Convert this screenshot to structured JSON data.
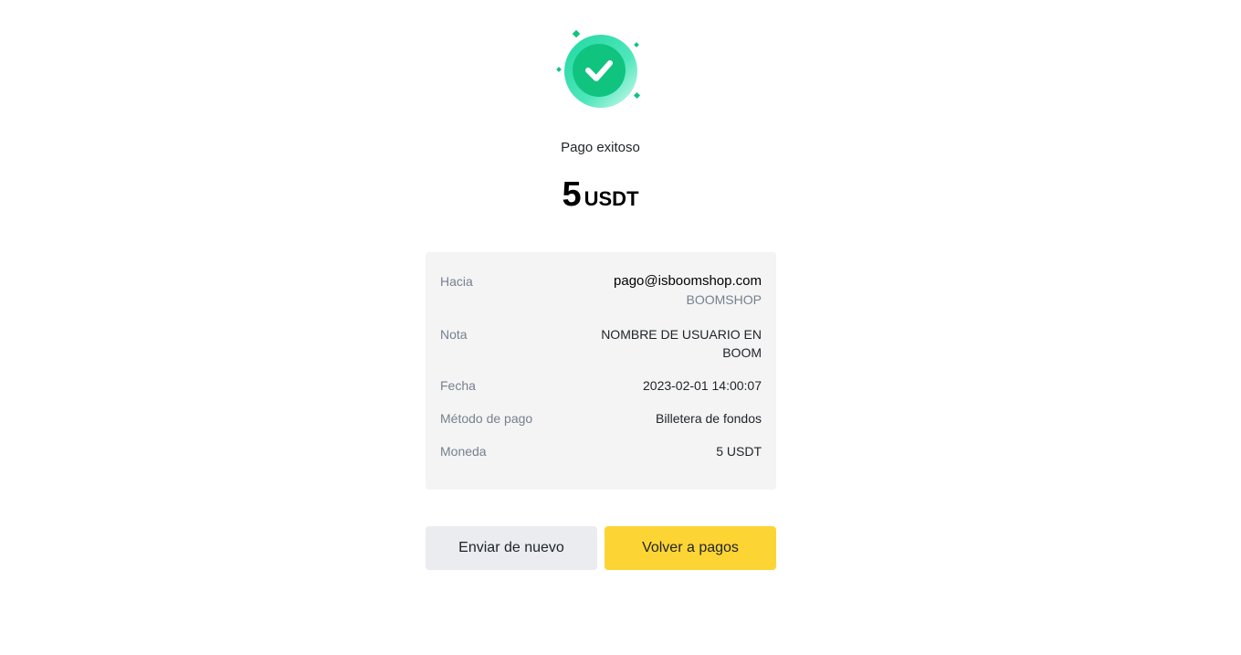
{
  "status": {
    "icon": "check-circle-icon",
    "title": "Pago exitoso"
  },
  "amount": {
    "value": "5",
    "currency": "USDT"
  },
  "details": {
    "to_label": "Hacia",
    "to_email": "pago@isboomshop.com",
    "to_name": "BOOMSHOP",
    "note_label": "Nota",
    "note_line1": "NOMBRE DE USUARIO EN",
    "note_line2": "BOOM",
    "date_label": "Fecha",
    "date_value": "2023-02-01 14:00:07",
    "method_label": "Método de pago",
    "method_value": "Billetera de fondos",
    "currency_label": "Moneda",
    "currency_value": "5 USDT"
  },
  "actions": {
    "send_again_label": "Enviar de nuevo",
    "back_label": "Volver a pagos"
  },
  "colors": {
    "success": "#0ecb81",
    "primary_button": "#fcd535",
    "secondary_button": "#eaecef"
  }
}
